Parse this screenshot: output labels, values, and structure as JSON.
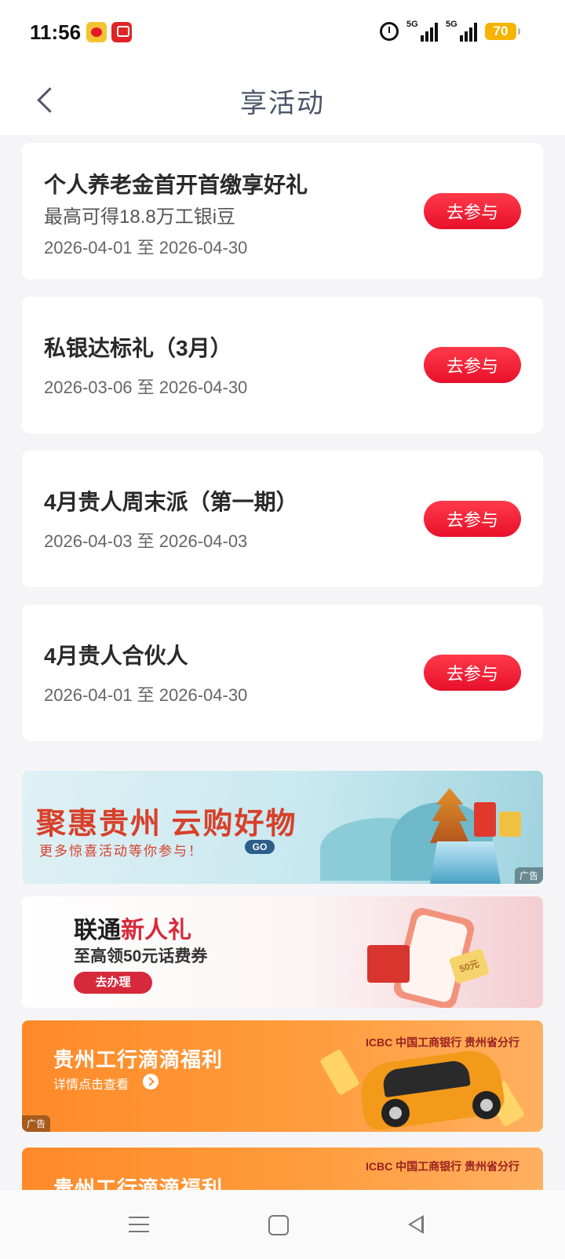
{
  "status_bar": {
    "time": "11:56",
    "signal1_label": "5G",
    "signal2_label": "5G",
    "battery": "70",
    "apps": [
      "weibo-icon",
      "news-app-icon"
    ]
  },
  "header": {
    "title": "享活动"
  },
  "activities": [
    {
      "title": "个人养老金首开首缴享好礼",
      "subtitle": "最高可得18.8万工银i豆",
      "date": "2026-04-01 至 2026-04-30",
      "button": "去参与"
    },
    {
      "title": "私银达标礼（3月）",
      "subtitle": "",
      "date": "2026-03-06 至 2026-04-30",
      "button": "去参与"
    },
    {
      "title": "4月贵人周末派（第一期）",
      "subtitle": "",
      "date": "2026-04-03 至 2026-04-03",
      "button": "去参与"
    },
    {
      "title": "4月贵人合伙人",
      "subtitle": "",
      "date": "2026-04-01 至 2026-04-30",
      "button": "去参与"
    }
  ],
  "banners": {
    "guizhou": {
      "headline": "聚惠贵州 云购好物",
      "subline": "更多惊喜活动等你参与！",
      "go": "GO",
      "ad": "广告"
    },
    "unicom": {
      "title_black": "联通",
      "title_red": "新人礼",
      "subtitle": "至高领50元话费券",
      "button": "去办理",
      "coupon": "50元"
    },
    "icbc1": {
      "title": "贵州工行滴滴福利",
      "subtitle": "详情点击查看",
      "brand": "ICBC 中国工商银行 贵州省分行",
      "ad": "广告"
    },
    "icbc2": {
      "title": "贵州工行滴滴福利",
      "brand": "ICBC 中国工商银行 贵州省分行"
    }
  },
  "colors": {
    "accent_red": "#e8102a",
    "brand_orange": "#ff8a2a",
    "background": "#f5f5f7"
  }
}
